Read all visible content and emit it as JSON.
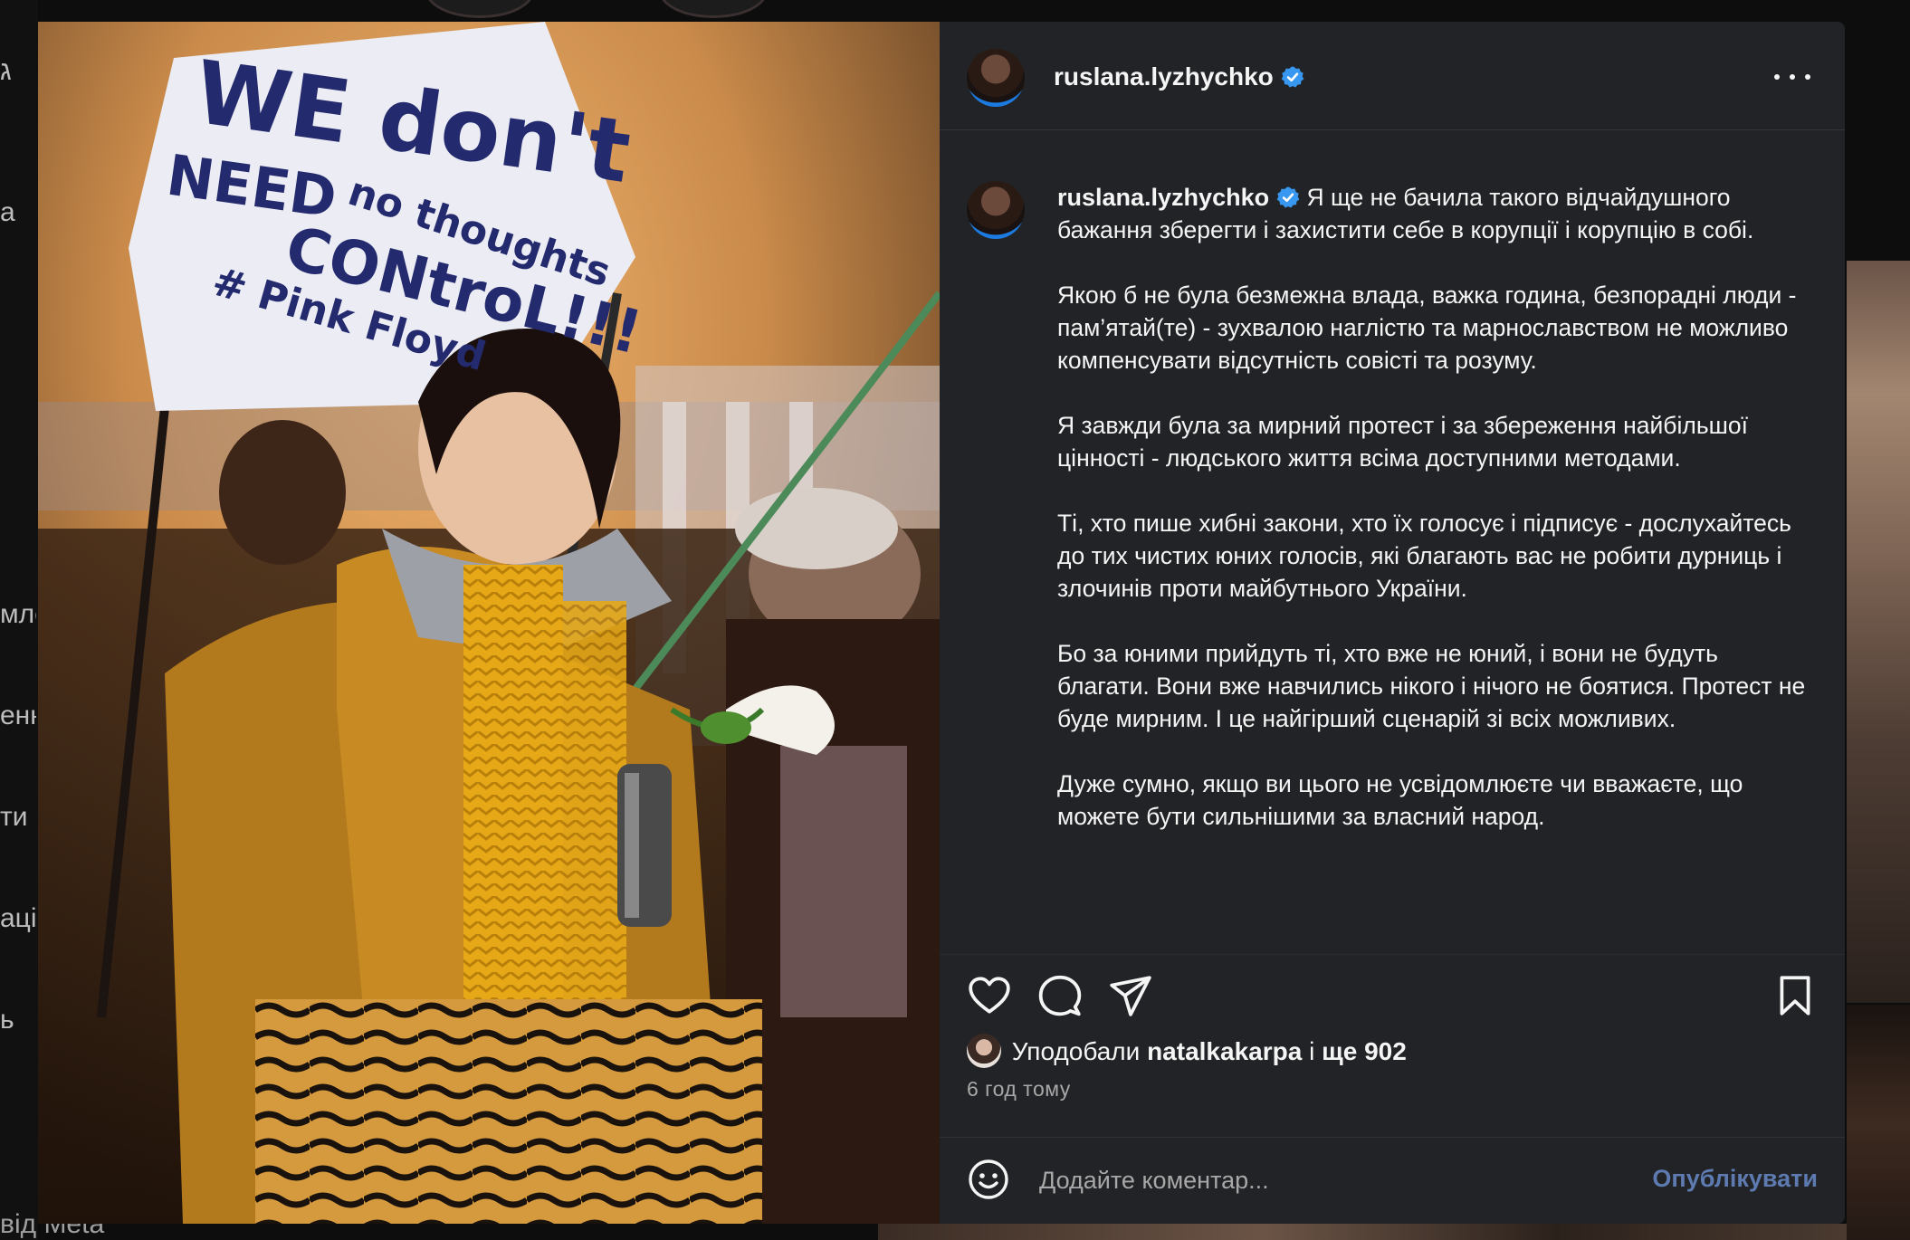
{
  "background": {
    "left_nav_fragments": [
      "ג",
      "a",
      "мле",
      "енн",
      "ти",
      "аці",
      "ь"
    ],
    "bottom_fragment": "від Meta"
  },
  "post": {
    "image_sign": {
      "line1": "WE don't",
      "line2": "NEED",
      "line3": "no thoughts",
      "line4": "CONtroL!!!",
      "line5": "# Pink Floyd"
    },
    "header": {
      "username": "ruslana.lyzhychko",
      "verified_icon": "verified-badge-icon",
      "more_icon": "more-horizontal-icon"
    },
    "caption": {
      "username": "ruslana.lyzhychko",
      "paragraphs": [
        "Я ще не бачила такого відчайдушного бажання зберегти і захистити себе в корупції і корупцію в собі.",
        "Якою б не була безмежна влада, важка година, безпорадні люди - пам’ятай(те) - зухвалою наглістю та марнославством не можливо компенсувати відсутність совісті та розуму.",
        "Я завжди була за мирний протест і за збереження найбільшої цінності - людського життя всіма доступними методами.",
        "Ті, хто пише хибні закони, хто їх голосує і підписує - дослухайтесь до тих чистих юних голосів, які благають вас не робити дурниць і злочинів проти майбутнього України.",
        "Бо за юними прийдуть ті, хто вже не юний, і вони не будуть благати. Вони вже навчились нікого і нічого не боятися. Протест не буде мирним. І це найгірший сценарій зі всіх можливих.",
        "Дуже сумно, якщо ви цього не усвідомлюєте чи вважаєте, що можете бути сильнішими за власний народ."
      ]
    },
    "actions": {
      "like_icon": "heart-icon",
      "comment_icon": "comment-bubble-icon",
      "share_icon": "paper-plane-icon",
      "save_icon": "bookmark-icon"
    },
    "likes": {
      "prefix": "Уподобали",
      "user": "natalkakarpa",
      "middle": "і",
      "suffix": "ще 902"
    },
    "time_ago": "6 год тому",
    "comment": {
      "placeholder": "Додайте коментар...",
      "post_label": "Опублікувати",
      "emoji_icon": "smiley-icon"
    },
    "colors": {
      "panel_bg": "#222326",
      "verified": "#3897f0",
      "post_button": "#5d7bb0",
      "secondary_text": "#a8a8a8"
    }
  }
}
